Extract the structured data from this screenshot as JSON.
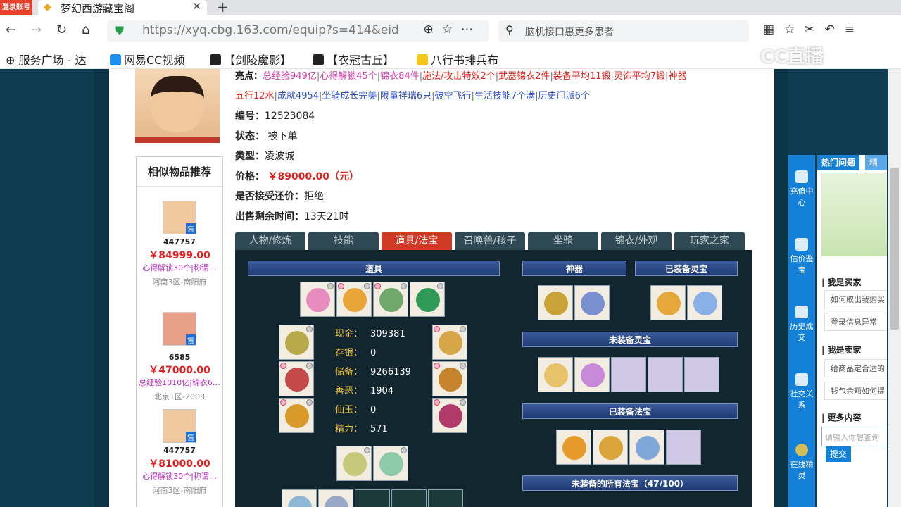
{
  "browser": {
    "login_badge": "登录账号",
    "tab_title": "梦幻西游藏宝阁",
    "url": "https://xyq.cbg.163.com/equip?s=414&eid",
    "search_text": "脑机接口惠更多患者",
    "bookmarks": [
      "服务广场 - 达",
      "网易CC视频",
      "【剑陵魔影】",
      "【衣冠古丘】",
      "八行书排兵布"
    ],
    "watermark": "CC直播"
  },
  "listing": {
    "highlights_label": "亮点：",
    "highlights_row1": [
      {
        "text": "总经验949亿",
        "color": "pink"
      },
      {
        "text": "心得解锁45个",
        "color": "pink"
      },
      {
        "text": "锦衣84件",
        "color": "pink"
      },
      {
        "text": "施法/攻击特效2个",
        "color": "red"
      },
      {
        "text": "武器锦衣2件",
        "color": "red"
      },
      {
        "text": "装备平均11锻",
        "color": "red"
      },
      {
        "text": "灵饰平均7锻",
        "color": "red"
      },
      {
        "text": "神器",
        "color": "red"
      }
    ],
    "highlights_row2": [
      {
        "text": "五行12水",
        "color": "red"
      },
      {
        "text": "成就4954",
        "color": "blue"
      },
      {
        "text": "坐骑成长完美",
        "color": "blue"
      },
      {
        "text": "限量祥瑞6只",
        "color": "blue"
      },
      {
        "text": "破空飞行",
        "color": "blue"
      },
      {
        "text": "生活技能7个满",
        "color": "blue"
      },
      {
        "text": "历史门派6个",
        "color": "blue"
      }
    ],
    "id_label": "编号：",
    "id_value": "12523084",
    "status_label": "状态：",
    "status_value": "被下单",
    "type_label": "类型：",
    "type_value": "凌波城",
    "price_label": "价格：",
    "price_value": "￥89000.00（元）",
    "counter_label": "是否接受还价：",
    "counter_value": "拒绝",
    "time_label": "出售剩余时间：",
    "time_value": "13天21时"
  },
  "similar": {
    "title": "相似物品推荐",
    "sold_badge": "售",
    "items": [
      {
        "id": "447757",
        "price": "￥84999.00",
        "tags": "心得解锁30个|称谓…",
        "server": "河南3区-南阳府"
      },
      {
        "id": "6585",
        "price": "￥47000.00",
        "tags": "总经验1010亿|锦衣6…",
        "server": "北京1区-2008"
      },
      {
        "id": "447757",
        "price": "￥81000.00",
        "tags": "心得解锁30个|称谓…",
        "server": "河南3区-南阳府"
      }
    ]
  },
  "tabs": [
    "人物/修炼",
    "技能",
    "道具/法宝",
    "召唤兽/孩子",
    "坐骑",
    "锦衣/外观",
    "玩家之家"
  ],
  "active_tab": 2,
  "panel": {
    "items_head": "道具",
    "shenqi_head": "神器",
    "equipped_lingbao_head": "已装备灵宝",
    "unequipped_lingbao_head": "未装备灵宝",
    "equipped_fabao_head": "已装备法宝",
    "unequipped_fabao_head": "未装备的所有法宝（47/100）",
    "stats": [
      {
        "label": "现金：",
        "value": "309381"
      },
      {
        "label": "存银：",
        "value": "0"
      },
      {
        "label": "储备：",
        "value": "9266139"
      },
      {
        "label": "善恶：",
        "value": "1904"
      },
      {
        "label": "仙玉：",
        "value": "0"
      },
      {
        "label": "精力：",
        "value": "571"
      }
    ]
  },
  "sidebar": {
    "buttons": [
      "充值中心",
      "估价鉴宝",
      "历史成交",
      "社交关系",
      "在线精灵"
    ],
    "tab_hot": "热门问题",
    "tab_other": "精灵",
    "buyer_head": "| 我是买家",
    "buyer_q": [
      "如何取出我购买",
      "登录信息异常"
    ],
    "seller_head": "| 我是卖家",
    "seller_q": [
      "给商品定合适的",
      "钱包余额如何提"
    ],
    "more_head": "| 更多内容",
    "input_placeholder": "请输入你想查询",
    "submit": "提交"
  }
}
